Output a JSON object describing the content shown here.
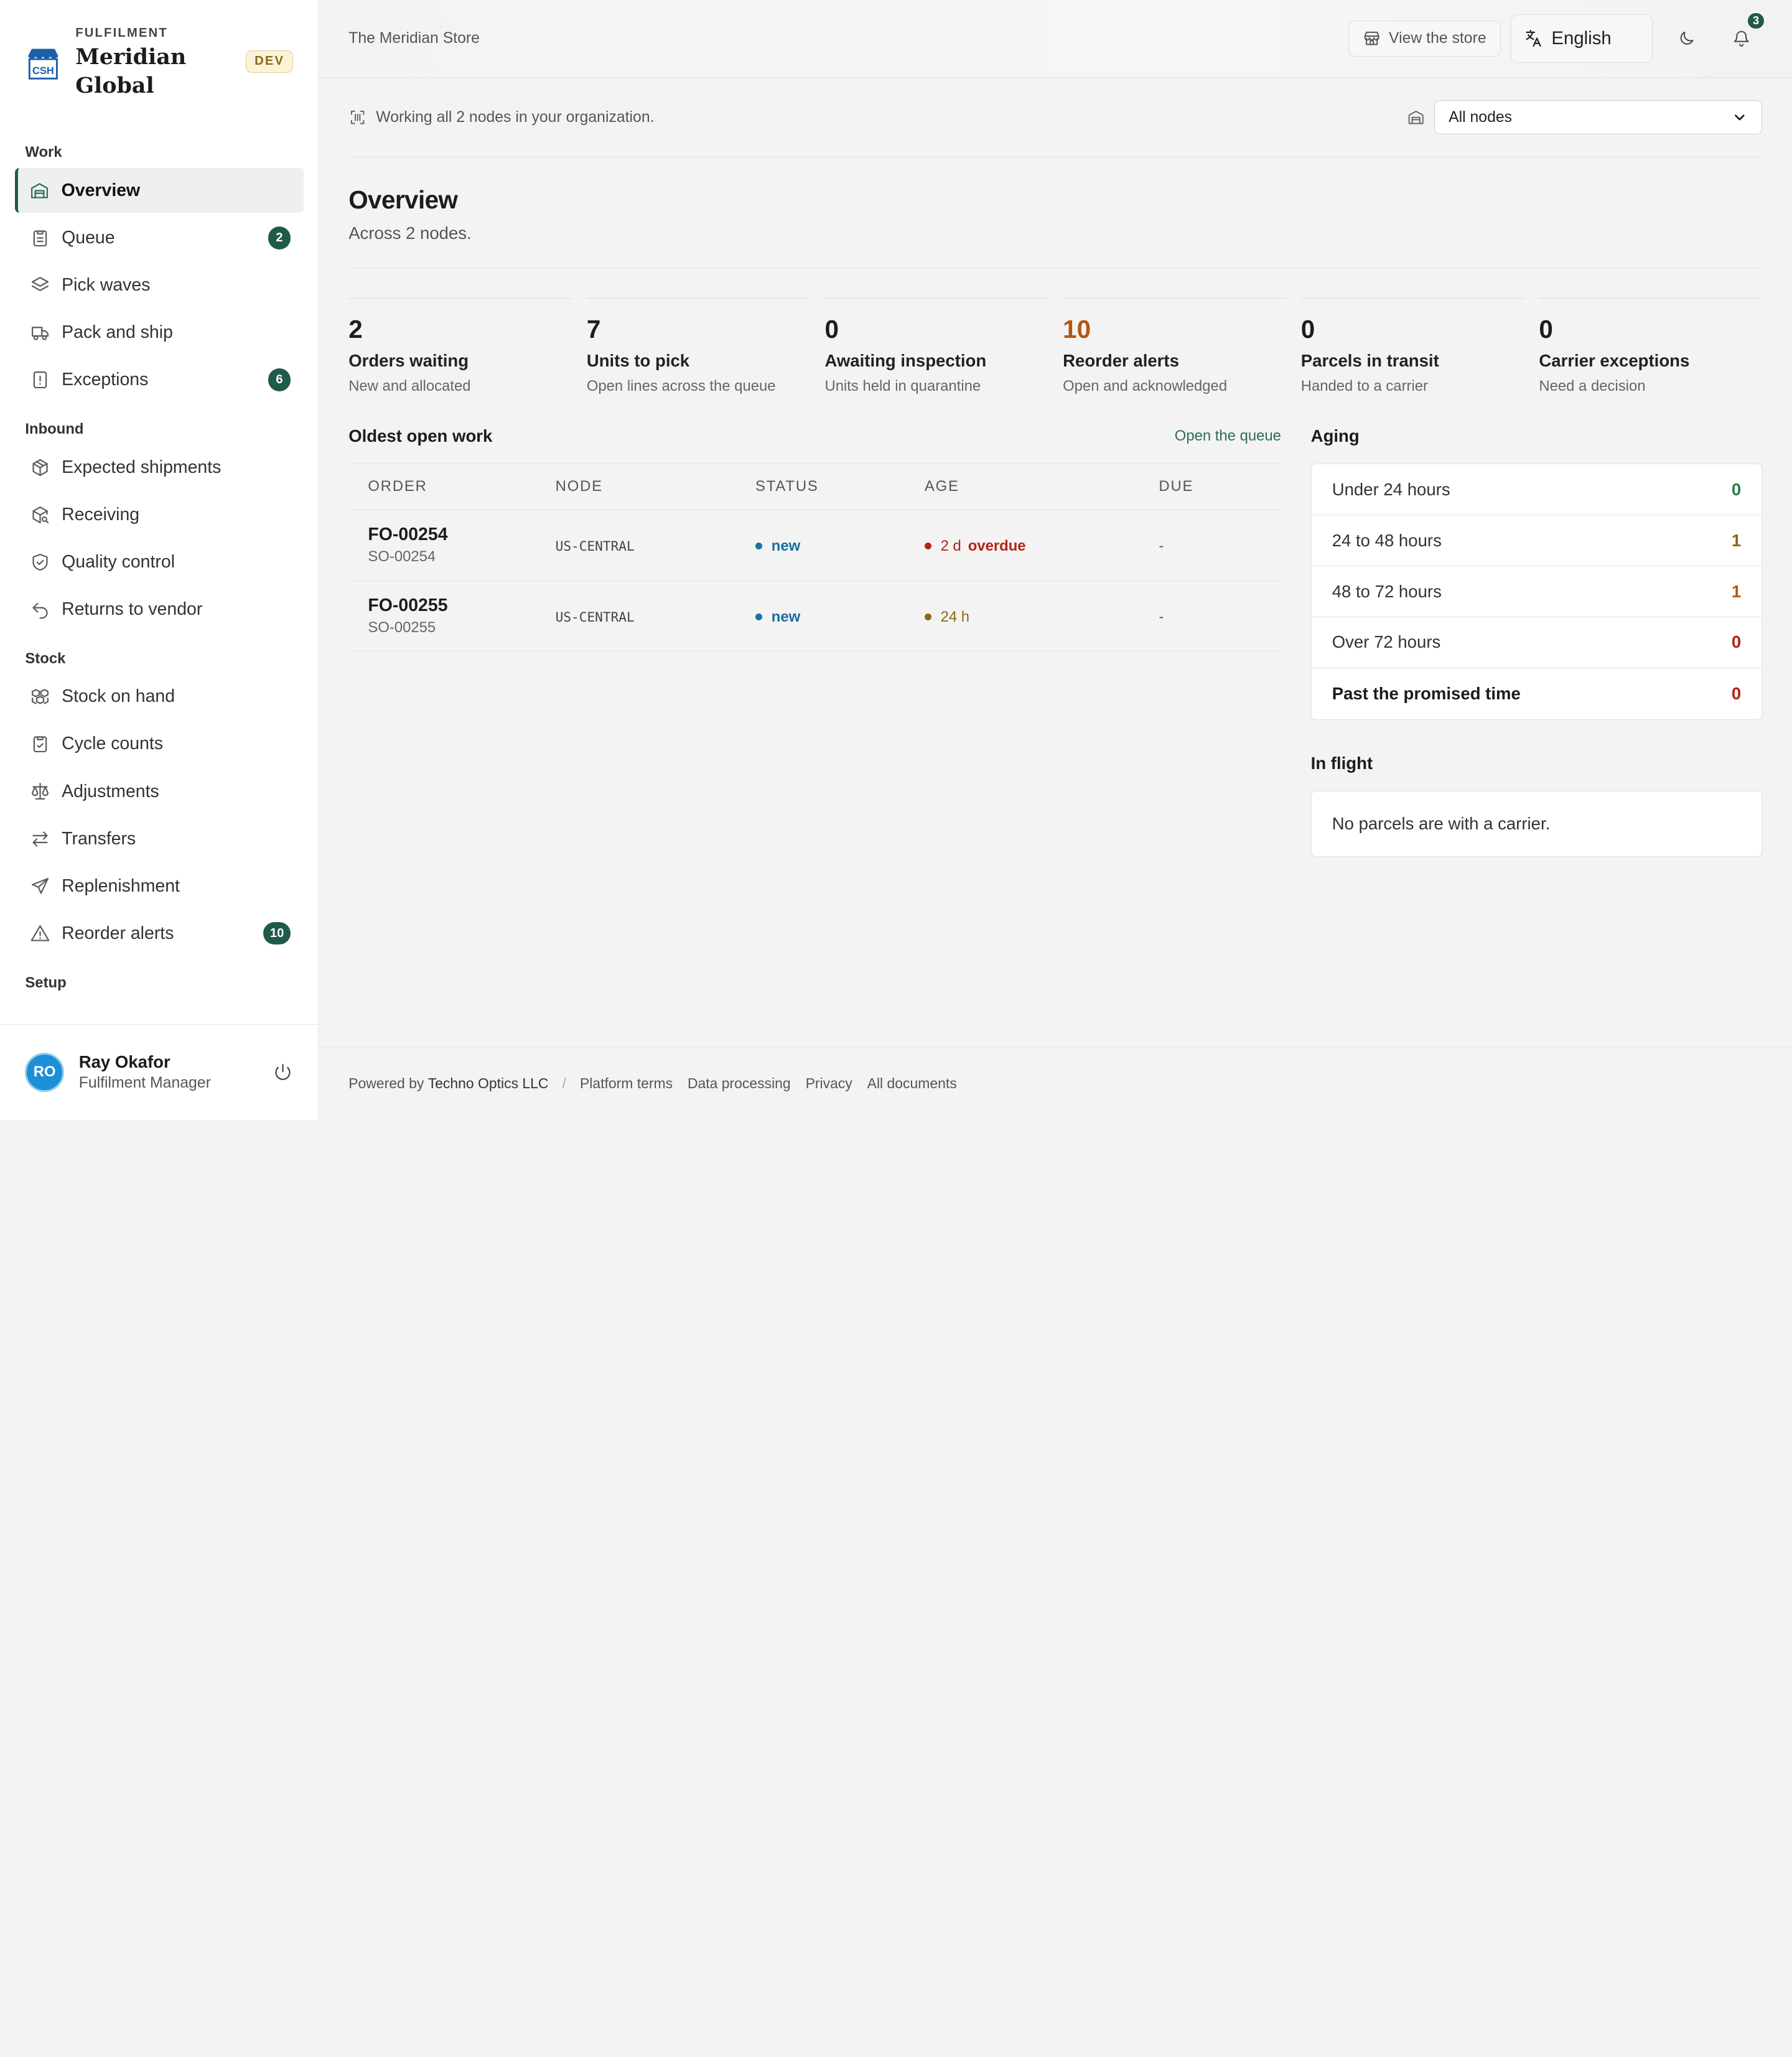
{
  "brand": {
    "kicker": "FULFILMENT",
    "name": "Meridian Global",
    "env": "DEV",
    "logo_text": "CSH"
  },
  "sidebar": {
    "sections": [
      {
        "title": "Work",
        "items": [
          {
            "label": "Overview",
            "icon": "warehouse-icon",
            "active": true
          },
          {
            "label": "Queue",
            "icon": "clipboard-icon",
            "count": "2"
          },
          {
            "label": "Pick waves",
            "icon": "layers-icon"
          },
          {
            "label": "Pack and ship",
            "icon": "truck-icon"
          },
          {
            "label": "Exceptions",
            "icon": "alert-file-icon",
            "count": "6"
          }
        ]
      },
      {
        "title": "Inbound",
        "items": [
          {
            "label": "Expected shipments",
            "icon": "package-icon"
          },
          {
            "label": "Receiving",
            "icon": "package-search-icon"
          },
          {
            "label": "Quality control",
            "icon": "shield-check-icon"
          },
          {
            "label": "Returns to vendor",
            "icon": "undo-icon"
          }
        ]
      },
      {
        "title": "Stock",
        "items": [
          {
            "label": "Stock on hand",
            "icon": "boxes-icon"
          },
          {
            "label": "Cycle counts",
            "icon": "clipboard-check-icon"
          },
          {
            "label": "Adjustments",
            "icon": "scale-icon"
          },
          {
            "label": "Transfers",
            "icon": "arrows-exchange-icon"
          },
          {
            "label": "Replenishment",
            "icon": "send-icon"
          },
          {
            "label": "Reorder alerts",
            "icon": "warning-triangle-icon",
            "count": "10"
          }
        ]
      },
      {
        "title": "Setup",
        "items": []
      }
    ]
  },
  "user": {
    "initials": "RO",
    "name": "Ray Okafor",
    "role": "Fulfilment Manager"
  },
  "topbar": {
    "store": "The Meridian Store",
    "view_store": "View the store",
    "language": "English",
    "notifications": "3"
  },
  "scope": {
    "text": "Working all 2 nodes in your organization.",
    "select_value": "All nodes"
  },
  "page": {
    "title": "Overview",
    "subtitle": "Across 2 nodes."
  },
  "kpis": [
    {
      "value": "2",
      "label": "Orders waiting",
      "sub": "New and allocated"
    },
    {
      "value": "7",
      "label": "Units to pick",
      "sub": "Open lines across the queue"
    },
    {
      "value": "0",
      "label": "Awaiting inspection",
      "sub": "Units held in quarantine"
    },
    {
      "value": "10",
      "label": "Reorder alerts",
      "sub": "Open and acknowledged",
      "warn": true
    },
    {
      "value": "0",
      "label": "Parcels in transit",
      "sub": "Handed to a carrier"
    },
    {
      "value": "0",
      "label": "Carrier exceptions",
      "sub": "Need a decision"
    }
  ],
  "work": {
    "title": "Oldest open work",
    "link": "Open the queue",
    "columns": [
      "ORDER",
      "NODE",
      "STATUS",
      "AGE",
      "DUE"
    ],
    "rows": [
      {
        "order": "FO-00254",
        "so": "SO-00254",
        "node": "US-CENTRAL",
        "status": "new",
        "age": "2 d",
        "age_flag": "overdue",
        "age_color": "#b42318",
        "due": "-"
      },
      {
        "order": "FO-00255",
        "so": "SO-00255",
        "node": "US-CENTRAL",
        "status": "new",
        "age": "24 h",
        "age_flag": "",
        "age_color": "#8a6a10",
        "due": "-"
      }
    ]
  },
  "aging": {
    "title": "Aging",
    "rows": [
      {
        "label": "Under 24 hours",
        "value": "0",
        "color": "#2e7d4f"
      },
      {
        "label": "24 to 48 hours",
        "value": "1",
        "color": "#8a6a10"
      },
      {
        "label": "48 to 72 hours",
        "value": "1",
        "color": "#b5560f"
      },
      {
        "label": "Over 72 hours",
        "value": "0",
        "color": "#b42318"
      },
      {
        "label": "Past the promised time",
        "value": "0",
        "color": "#b42318",
        "bold": true
      }
    ]
  },
  "in_flight": {
    "title": "In flight",
    "empty": "No parcels are with a carrier."
  },
  "footer": {
    "powered": "Powered by",
    "company": "Techno Optics LLC",
    "links": [
      "Platform terms",
      "Data processing",
      "Privacy",
      "All documents"
    ]
  },
  "colors": {
    "accent": "#1f5b4a",
    "warn": "#b5560f",
    "danger": "#b42318"
  }
}
